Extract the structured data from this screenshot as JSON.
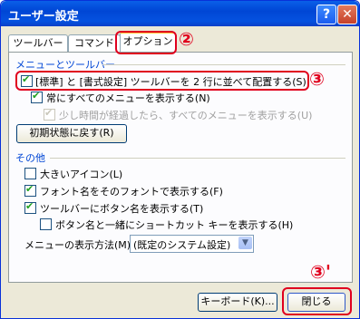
{
  "window": {
    "title": "ユーザー設定",
    "help": "?",
    "close": "✕"
  },
  "tabs": [
    {
      "label": "ツールバー"
    },
    {
      "label": "コマンド"
    },
    {
      "label": "オプション"
    }
  ],
  "groups": {
    "menus_toolbars": {
      "title": "メニューとツールバー",
      "options": [
        {
          "label": "[標準] と [書式設定] ツールバーを 2 行に並べて配置する(S)",
          "checked": true
        },
        {
          "label": "常にすべてのメニューを表示する(N)",
          "checked": true
        },
        {
          "label": "少し時間が経過したら、すべてのメニューを表示する(U)",
          "checked": true,
          "disabled": true
        }
      ],
      "reset_button": "初期状態に戻す(R)"
    },
    "other": {
      "title": "その他",
      "options": [
        {
          "label": "大きいアイコン(L)",
          "checked": false
        },
        {
          "label": "フォント名をそのフォントで表示する(F)",
          "checked": true
        },
        {
          "label": "ツールバーにボタン名を表示する(T)",
          "checked": true
        },
        {
          "label": "ボタン名と一緒にショートカット キーを表示する(H)",
          "checked": false
        }
      ],
      "menu_animation_label": "メニューの表示方法(M):",
      "menu_animation_value": "(既定のシステム設定)"
    }
  },
  "buttons": {
    "keyboard": "キーボード(K)...",
    "close": "閉じる"
  },
  "callouts": {
    "tab": "②",
    "option": "③",
    "close": "③'"
  },
  "colors": {
    "highlight": "#e0001e",
    "title_bar": "#0046d5"
  }
}
